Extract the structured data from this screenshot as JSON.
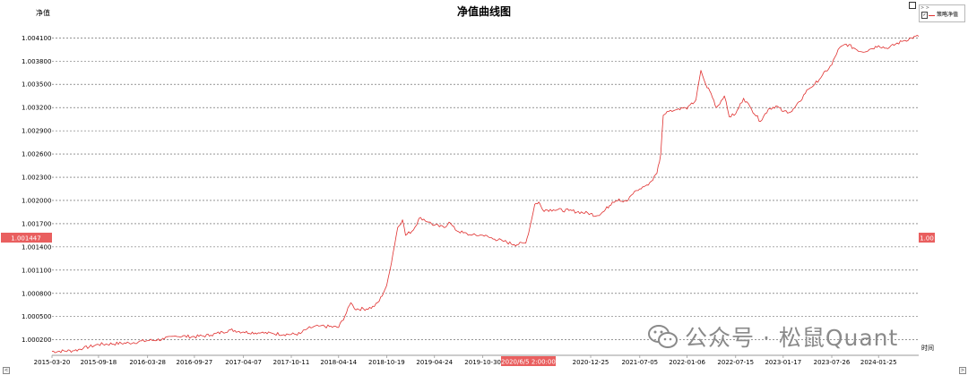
{
  "chart_data": {
    "type": "line",
    "title": "净值曲线图",
    "ylabel": "净值",
    "xlabel": "时间",
    "ylim": [
      1.0,
      1.0043
    ],
    "y_ticks": [
      "1.004100",
      "1.003800",
      "1.003500",
      "1.003200",
      "1.002900",
      "1.002600",
      "1.002300",
      "1.002000",
      "1.001700",
      "1.001400",
      "1.001100",
      "1.000800",
      "1.000500",
      "1.000200"
    ],
    "x_ticks": [
      "2015-03-20",
      "2015-09-18",
      "2016-03-28",
      "2016-09-27",
      "2017-04-07",
      "2017-10-11",
      "2018-04-14",
      "2018-10-19",
      "2019-04-24",
      "2019-10-30",
      "2020-12-25",
      "2021-07-05",
      "2022-01-06",
      "2022-07-15",
      "2023-01-17",
      "2023-07-26",
      "2024-01-25"
    ],
    "x_range": [
      "2015-03-20",
      "2024-06-30"
    ],
    "legend": {
      "position": "top-right",
      "entries": [
        "策略净值"
      ]
    },
    "grid": "horizontal-dashed",
    "cursor": {
      "y_value": "1.001447",
      "x_value": "2020/6/5 2:00:00",
      "right_value": "1.00"
    },
    "series": [
      {
        "name": "策略净值",
        "color": "#e0302f",
        "points": [
          [
            "2015-03-20",
            1.00005
          ],
          [
            "2015-06-15",
            1.00006
          ],
          [
            "2015-07-20",
            1.00009
          ],
          [
            "2015-09-18",
            1.00014
          ],
          [
            "2016-01-15",
            1.00016
          ],
          [
            "2016-03-28",
            1.00019
          ],
          [
            "2016-06-01",
            1.00021
          ],
          [
            "2016-07-15",
            1.00025
          ],
          [
            "2016-09-27",
            1.00024
          ],
          [
            "2016-12-01",
            1.00026
          ],
          [
            "2017-01-15",
            1.0003
          ],
          [
            "2017-02-15",
            1.00033
          ],
          [
            "2017-04-07",
            1.0003
          ],
          [
            "2017-06-15",
            1.00029
          ],
          [
            "2017-08-01",
            1.00028
          ],
          [
            "2017-10-11",
            1.00027
          ],
          [
            "2017-11-15",
            1.00028
          ],
          [
            "2017-12-15",
            1.00035
          ],
          [
            "2018-02-01",
            1.00038
          ],
          [
            "2018-04-14",
            1.00036
          ],
          [
            "2018-05-15",
            1.00055
          ],
          [
            "2018-06-01",
            1.00068
          ],
          [
            "2018-06-15",
            1.0006
          ],
          [
            "2018-08-01",
            1.0006
          ],
          [
            "2018-09-01",
            1.00063
          ],
          [
            "2018-09-20",
            1.0007
          ],
          [
            "2018-10-19",
            1.0009
          ],
          [
            "2018-11-01",
            1.0011
          ],
          [
            "2018-12-01",
            1.00165
          ],
          [
            "2018-12-20",
            1.00175
          ],
          [
            "2019-01-01",
            1.00155
          ],
          [
            "2019-02-01",
            1.00162
          ],
          [
            "2019-02-20",
            1.00175
          ],
          [
            "2019-03-01",
            1.00178
          ],
          [
            "2019-04-01",
            1.00172
          ],
          [
            "2019-04-24",
            1.00168
          ],
          [
            "2019-06-01",
            1.00165
          ],
          [
            "2019-06-20",
            1.00172
          ],
          [
            "2019-07-15",
            1.00162
          ],
          [
            "2019-08-15",
            1.00158
          ],
          [
            "2019-09-15",
            1.00155
          ],
          [
            "2019-10-30",
            1.00155
          ],
          [
            "2019-12-15",
            1.0015
          ],
          [
            "2020-01-15",
            1.00148
          ],
          [
            "2020-03-01",
            1.00143
          ],
          [
            "2020-04-15",
            1.00145
          ],
          [
            "2020-05-01",
            1.00165
          ],
          [
            "2020-05-20",
            1.00195
          ],
          [
            "2020-06-05",
            1.00198
          ],
          [
            "2020-06-20",
            1.00188
          ],
          [
            "2020-08-01",
            1.00188
          ],
          [
            "2020-10-01",
            1.00187
          ],
          [
            "2020-12-25",
            1.00183
          ],
          [
            "2021-01-15",
            1.0018
          ],
          [
            "2021-02-15",
            1.00186
          ],
          [
            "2021-03-20",
            1.00198
          ],
          [
            "2021-04-15",
            1.00202
          ],
          [
            "2021-05-01",
            1.00198
          ],
          [
            "2021-05-20",
            1.002
          ],
          [
            "2021-06-15",
            1.00212
          ],
          [
            "2021-07-05",
            1.00215
          ],
          [
            "2021-08-01",
            1.0022
          ],
          [
            "2021-08-20",
            1.00225
          ],
          [
            "2021-09-10",
            1.00235
          ],
          [
            "2021-09-25",
            1.0026
          ],
          [
            "2021-10-05",
            1.0031
          ],
          [
            "2021-10-20",
            1.00315
          ],
          [
            "2021-11-15",
            1.00316
          ],
          [
            "2021-12-15",
            1.0032
          ],
          [
            "2022-01-06",
            1.00318
          ],
          [
            "2022-02-10",
            1.0033
          ],
          [
            "2022-03-01",
            1.00368
          ],
          [
            "2022-03-20",
            1.0035
          ],
          [
            "2022-04-10",
            1.00338
          ],
          [
            "2022-05-01",
            1.0032
          ],
          [
            "2022-06-01",
            1.00335
          ],
          [
            "2022-06-20",
            1.00308
          ],
          [
            "2022-07-15",
            1.00312
          ],
          [
            "2022-08-15",
            1.00332
          ],
          [
            "2022-09-15",
            1.00318
          ],
          [
            "2022-10-20",
            1.00302
          ],
          [
            "2022-11-20",
            1.00318
          ],
          [
            "2022-12-20",
            1.00322
          ],
          [
            "2023-01-17",
            1.00315
          ],
          [
            "2023-02-20",
            1.00315
          ],
          [
            "2023-03-25",
            1.00328
          ],
          [
            "2023-04-20",
            1.00343
          ],
          [
            "2023-05-20",
            1.0035
          ],
          [
            "2023-06-20",
            1.00362
          ],
          [
            "2023-07-26",
            1.00375
          ],
          [
            "2023-08-20",
            1.00395
          ],
          [
            "2023-09-20",
            1.00402
          ],
          [
            "2023-10-20",
            1.00397
          ],
          [
            "2023-11-20",
            1.00392
          ],
          [
            "2023-12-20",
            1.00395
          ],
          [
            "2024-01-25",
            1.004
          ],
          [
            "2024-03-01",
            1.00396
          ],
          [
            "2024-04-01",
            1.00402
          ],
          [
            "2024-05-01",
            1.00406
          ],
          [
            "2024-06-01",
            1.0041
          ],
          [
            "2024-06-30",
            1.00412
          ]
        ]
      }
    ]
  },
  "ui": {
    "legend_toggle": "> >",
    "legend_check": "✓",
    "scroll_left": "<",
    "scroll_right": ">",
    "accent_color": "#e0302f"
  },
  "watermark": {
    "text": "公众号 · 松鼠Quant",
    "icon": "wechat-icon"
  }
}
